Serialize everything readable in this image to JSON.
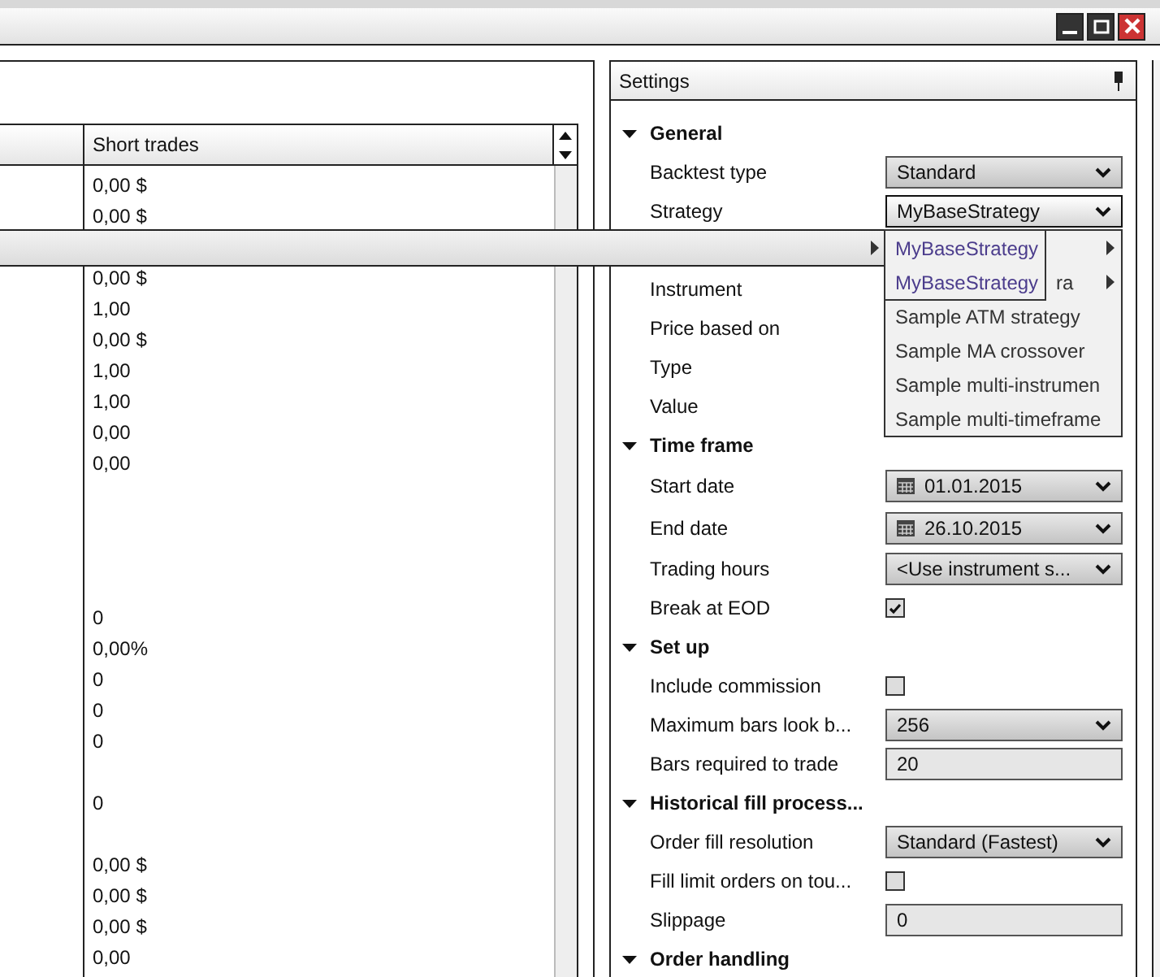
{
  "window": {
    "controls": [
      {
        "kind": "minimize"
      },
      {
        "kind": "maximize"
      },
      {
        "kind": "close"
      }
    ]
  },
  "results_table": {
    "columns": [
      {},
      {
        "label": "Short trades"
      }
    ],
    "rows": [
      {
        "short_trades": "0,00 $"
      },
      {
        "short_trades": "0,00 $"
      },
      {},
      {
        "short_trades": "0,00 $"
      },
      {
        "short_trades": "1,00"
      },
      {
        "short_trades": "0,00 $"
      },
      {
        "short_trades": "1,00"
      },
      {
        "short_trades": "1,00"
      },
      {
        "short_trades": "0,00"
      },
      {
        "short_trades": "0,00"
      },
      {},
      {},
      {},
      {},
      {
        "short_trades": "0"
      },
      {
        "short_trades": "0,00%"
      },
      {
        "short_trades": "0"
      },
      {
        "short_trades": "0"
      },
      {
        "short_trades": "0"
      },
      {},
      {
        "short_trades": "0"
      },
      {},
      {
        "short_trades": "0,00 $"
      },
      {
        "short_trades": "0,00 $"
      },
      {
        "short_trades": "0,00 $"
      },
      {
        "short_trades": "0,00"
      }
    ]
  },
  "settings": {
    "title": "Settings",
    "sections": [
      {
        "title": "General",
        "expanded": true,
        "rows": [
          {
            "kind": "dropdown",
            "label": "Backtest type",
            "value": "Standard"
          },
          {
            "kind": "open-dropdown",
            "label": "Strategy",
            "value": "MyBaseStrategy"
          },
          {
            "kind": "covered"
          },
          {
            "kind": "label",
            "label": "Instrument"
          },
          {
            "kind": "label",
            "label": "Price based on"
          },
          {
            "kind": "label",
            "label": "Type"
          },
          {
            "kind": "label",
            "label": "Value"
          }
        ]
      },
      {
        "title": "Time frame",
        "expanded": true,
        "rows": [
          {
            "kind": "date",
            "label": "Start date",
            "value": "01.01.2015"
          },
          {
            "kind": "date",
            "label": "End date",
            "value": "26.10.2015"
          },
          {
            "kind": "dropdown",
            "label": "Trading hours",
            "value": "<Use instrument s..."
          },
          {
            "kind": "checkbox",
            "label": "Break at EOD",
            "checked": true
          }
        ]
      },
      {
        "title": "Set up",
        "expanded": true,
        "rows": [
          {
            "kind": "checkbox",
            "label": "Include commission",
            "checked": false
          },
          {
            "kind": "dropdown",
            "label": "Maximum bars look b...",
            "value": "256"
          },
          {
            "kind": "text",
            "label": "Bars required to trade",
            "value": "20"
          }
        ]
      },
      {
        "title": "Historical fill process...",
        "expanded": true,
        "rows": [
          {
            "kind": "dropdown",
            "label": "Order fill resolution",
            "value": "Standard (Fastest)"
          },
          {
            "kind": "checkbox",
            "label": "Fill limit orders on tou...",
            "checked": false
          },
          {
            "kind": "text",
            "label": "Slippage",
            "value": "0"
          }
        ]
      },
      {
        "title": "Order handling",
        "expanded": true
      }
    ]
  },
  "context_menu": {
    "item": {
      "has_submenu": true
    }
  },
  "strategy_list": {
    "items": [
      {
        "kind": "covered",
        "has_submenu": true
      },
      {
        "kind": "partial",
        "label": "ra",
        "has_submenu": true
      },
      {
        "kind": "item",
        "label": "Sample ATM strategy",
        "has_submenu": false
      },
      {
        "kind": "item",
        "label": "Sample MA crossover",
        "has_submenu": false
      },
      {
        "kind": "item",
        "label": "Sample multi-instrumen",
        "has_submenu": false
      },
      {
        "kind": "item",
        "label": "Sample multi-timeframe",
        "has_submenu": false
      }
    ]
  },
  "submenu": {
    "items": [
      "MyBaseStrategy",
      "MyBaseStrategy"
    ]
  }
}
